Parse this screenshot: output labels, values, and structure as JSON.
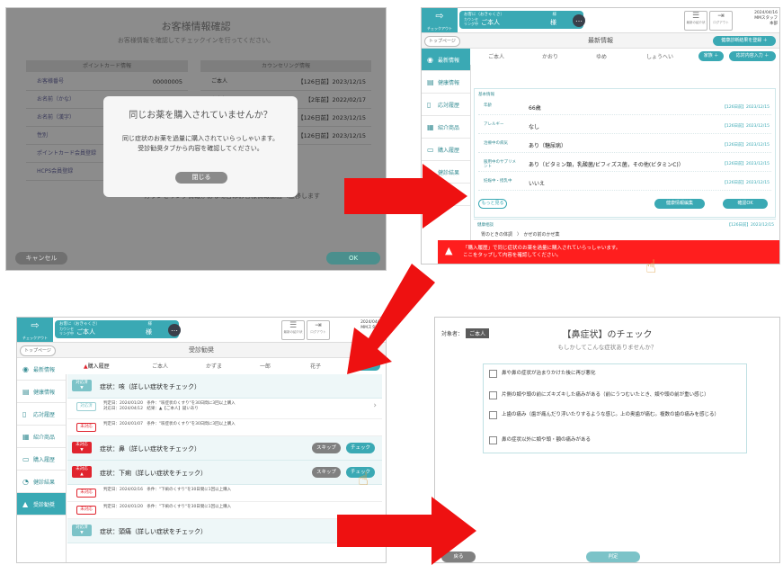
{
  "panel1": {
    "title": "お客様情報確認",
    "subtitle": "お客様情報を確認してチェックインを行ってください。",
    "left_header": "ポイントカード情報",
    "right_header": "カウンセリング情報",
    "rows_left": [
      {
        "label": "お客様番号",
        "value": "00000005"
      },
      {
        "label": "お名前（かな）",
        "value": "おきゃくさ"
      },
      {
        "label": "お名前（漢字）",
        "value": ""
      },
      {
        "label": "性別",
        "value": ""
      },
      {
        "label": "ポイントカード会員登録",
        "value": ""
      },
      {
        "label": "HCPS会員登録",
        "value": ""
      }
    ],
    "rows_right": [
      {
        "label": "ご本人",
        "value": "【126日前】2023/12/15"
      },
      {
        "label": "かおり",
        "value": "【2年前】2022/02/17"
      },
      {
        "label": "",
        "value": "【126日前】2023/12/15"
      },
      {
        "label": "",
        "value": "【126日前】2023/12/15"
      }
    ],
    "note": "カウンセリング情報がある場合はお客様情報画面へ遷移します",
    "cancel_label": "キャンセル",
    "ok_label": "OK",
    "modal": {
      "title": "同じお薬を購入されていませんか？",
      "line1": "同じ症状のお薬を過量に購入されていらっしゃいます。",
      "line2": "受診勧奨タブから内容を確認してください。",
      "close_label": "閉じる"
    }
  },
  "header": {
    "brand_text": "チェックアウト",
    "customer_line1": "お客に（おきゃくさ）",
    "customer_line1_right": "様",
    "customer_sub": "カウンセリング中",
    "customer_name": "ご本人",
    "customer_sama": "様",
    "btn1_label": "最新の紹介状",
    "btn2_label": "ログアウト",
    "staff_date": "2024/04/16",
    "staff_name": "MMスタッフ",
    "staff_store": "本部"
  },
  "sidebar": {
    "items": [
      {
        "label": "最新情報",
        "icon": "◉"
      },
      {
        "label": "健康情報",
        "icon": "▤"
      },
      {
        "label": "応対履歴",
        "icon": "▯"
      },
      {
        "label": "紹介商品",
        "icon": "▦"
      },
      {
        "label": "購入履歴",
        "icon": "▭"
      },
      {
        "label": "健診結果",
        "icon": "◔"
      },
      {
        "label": "受診勧奨",
        "icon": "▲"
      }
    ]
  },
  "panel2": {
    "top_button": "トップページ",
    "page_title": "最新情報",
    "register_button": "健康診断結果を登録 ＋",
    "tabs": [
      "ご本人",
      "かおり",
      "ゆめ",
      "しょうへい"
    ],
    "family_button": "家族 ＋",
    "response_button": "応対内容入力 ＋",
    "card_title": "基本情報",
    "rows": [
      {
        "key": "年齢",
        "value": "66歳",
        "date": "【126日前】2023/12/15"
      },
      {
        "key": "アレルギー",
        "value": "なし",
        "date": "【126日前】2023/12/15"
      },
      {
        "key": "治療中の病気",
        "value": "あり（糖尿病）",
        "date": "【126日前】2023/12/15"
      },
      {
        "key": "服用中のサプリメント",
        "value": "あり（ビタミン類，乳酸菌/ビフィズス菌，その他(ビタミンC)）",
        "date": "【126日前】2023/12/15"
      },
      {
        "key": "妊娠中・授乳中",
        "value": "いいえ",
        "date": "【126日前】2023/12/15"
      }
    ],
    "more_button": "もっと見る",
    "edit_button": "健康情報編集",
    "confirm_button": "確認OK",
    "sec2_title": "健康相談",
    "sec2_date": "【126日前】2023/12/15",
    "sec2_line": "胃のときの体調　〉　かぜの前のかぜ薬",
    "alert_line1": "「購入履歴」で同じ症状のお薬を過量に購入されていらっしゃいます。",
    "alert_line2": "ここをタップして内容を確認してください。"
  },
  "panel3": {
    "page_title": "受診勧奨",
    "tabs": [
      "購入履歴",
      "ご本人",
      "かずま",
      "一郎",
      "花子"
    ],
    "family_button": "家族 ＋",
    "items": [
      {
        "tag": "対応済",
        "tag_sub": "▼",
        "tag_color": "teal",
        "title": "症状：咳（詳しい症状をチェック）",
        "buttons": false,
        "subs": [
          {
            "tag": "対応済",
            "tag_color": "teal",
            "line1": "判定日：2024/01/20　条件：\"咳症状のくすり\"を30日間に3回以上購入",
            "line2": "対応日：2024/04/12　結果：▲【ご本人】疑いあり",
            "chev": true
          },
          {
            "tag": "未対応",
            "tag_color": "red",
            "line1": "判定日：2024/01/07　条件：\"咳症状のくすり\"を30日間に3回以上購入",
            "line2": "",
            "chev": false
          }
        ]
      },
      {
        "tag": "未対応",
        "tag_sub": "▼",
        "tag_color": "red",
        "title": "症状：鼻（詳しい症状をチェック）",
        "buttons": true,
        "subs": []
      },
      {
        "tag": "未対応",
        "tag_sub": "▲",
        "tag_color": "red",
        "title": "症状：下痢（詳しい症状をチェック）",
        "buttons": true,
        "subs": [
          {
            "tag": "未対応",
            "tag_color": "red",
            "line1": "判定日：2024/02/16　条件：\"下痢のくすり\"を30日間に1回以上購入",
            "line2": "",
            "chev": false
          },
          {
            "tag": "未対応",
            "tag_color": "red",
            "line1": "判定日：2024/01/20　条件：\"下痢のくすり\"を30日間に1回以上購入",
            "line2": "",
            "chev": false
          }
        ]
      },
      {
        "tag": "対応済",
        "tag_sub": "▼",
        "tag_color": "teal",
        "title": "症状：頭痛（詳しい症状をチェック）",
        "buttons": false,
        "subs": []
      }
    ],
    "skip_label": "スキップ",
    "check_label": "チェック"
  },
  "panel4": {
    "target_label": "対象者：",
    "target_name": "ご本人",
    "title": "【鼻症状】のチェック",
    "subtitle": "もしかしてこんな症状ありませんか？",
    "options": [
      "鼻や鼻の症状が治まりかけた後に再び悪化",
      "片側の頬や頭の前にズキズキした痛みがある（前にうつむいたとき、頬や頭の前が重い感じ）",
      "上歯の痛み（歯が痛んだり浮いたりするような感じ。上の奥歯が痛む。複数の歯の痛みを感じる）",
      "鼻の症状以外に頬や頭・額の痛みがある"
    ],
    "back_label": "戻る",
    "judge_label": "判定"
  },
  "colors": {
    "teal": "#3aa9b4",
    "red": "#ff1e1e",
    "arrow_red": "#ee1111"
  }
}
